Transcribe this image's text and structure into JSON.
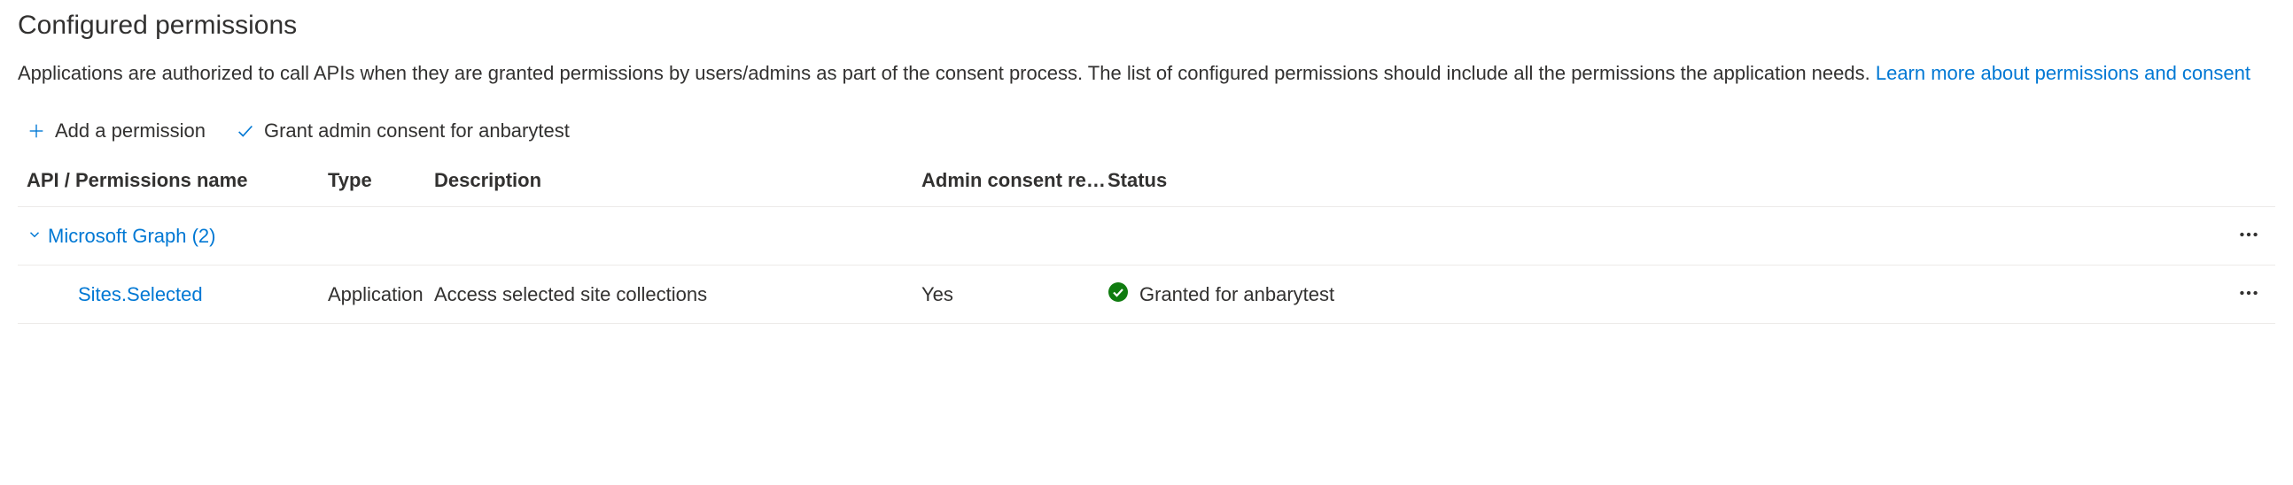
{
  "section": {
    "title": "Configured permissions",
    "description_prefix": "Applications are authorized to call APIs when they are granted permissions by users/admins as part of the consent process. The list of configured permissions should include all the permissions the application needs. ",
    "learn_more": "Learn more about permissions and consent"
  },
  "toolbar": {
    "add_permission_label": "Add a permission",
    "grant_consent_label": "Grant admin consent for anbarytest"
  },
  "table": {
    "headers": {
      "api_name": "API / Permissions name",
      "type": "Type",
      "description": "Description",
      "admin_consent": "Admin consent requ...",
      "status": "Status"
    },
    "group": {
      "name": "Microsoft Graph (2)"
    },
    "row": {
      "name": "Sites.Selected",
      "type": "Application",
      "description": "Access selected site collections",
      "admin_consent": "Yes",
      "status": "Granted for anbarytest"
    }
  }
}
